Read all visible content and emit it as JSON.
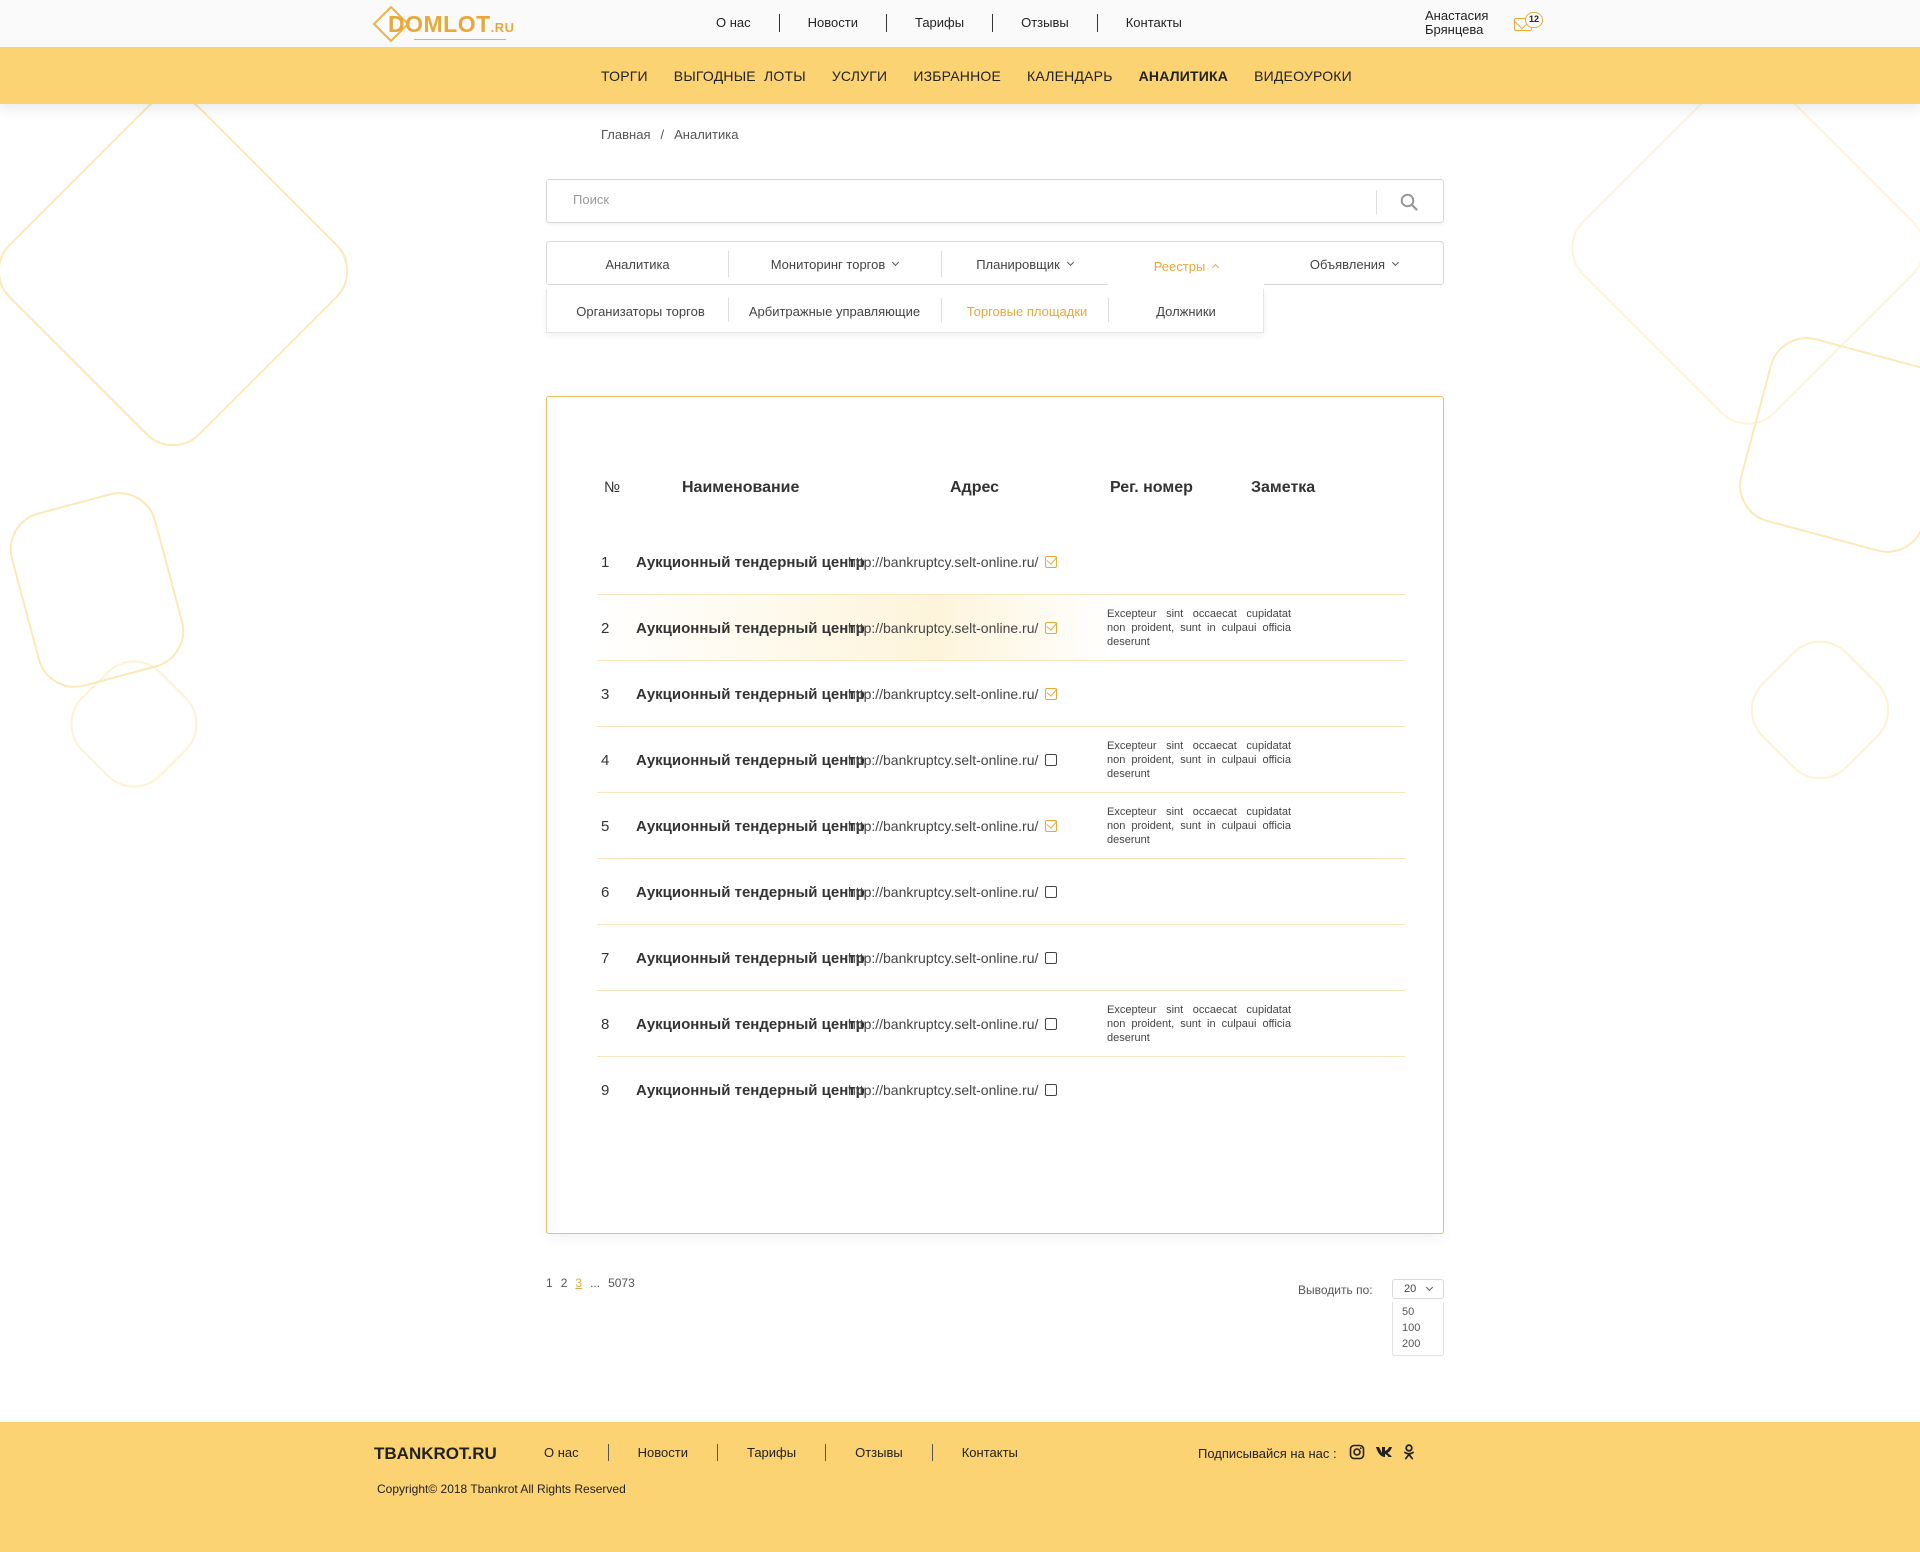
{
  "header": {
    "logo_main": "DOMLOT",
    "logo_suffix": ".RU",
    "top_nav": [
      "О нас",
      "Новости",
      "Тарифы",
      "Отзывы",
      "Контакты"
    ],
    "user_first_name": "Анастасия",
    "user_last_name": "Брянцева",
    "mail_count": "12"
  },
  "main_nav": [
    "ТОРГИ",
    "ВЫГОДНЫЕ  ЛОТЫ",
    "УСЛУГИ",
    "ИЗБРАННОЕ",
    "КАЛЕНДАРЬ",
    "АНАЛИТИКА",
    "ВИДЕОУРОКИ"
  ],
  "main_nav_active": "АНАЛИТИКА",
  "breadcrumb": {
    "home": "Главная",
    "separator": "/",
    "current": "Аналитика"
  },
  "search": {
    "placeholder": "Поиск",
    "value": ""
  },
  "tabs": [
    {
      "label": "Аналитика",
      "dropdown": false
    },
    {
      "label": "Мониторинг торгов",
      "dropdown": true
    },
    {
      "label": "Планировщик",
      "dropdown": true
    },
    {
      "label": "Реестры",
      "dropdown": true,
      "open": true
    },
    {
      "label": "Объявления",
      "dropdown": true
    }
  ],
  "subtabs": [
    "Организаторы торгов",
    "Арбитражные управляющие",
    "Торговые площадки",
    "Должники"
  ],
  "subtab_active": "Торговые площадки",
  "table": {
    "headers": {
      "num": "№",
      "name": "Наименование",
      "address": "Адрес",
      "reg": "Рег. номер",
      "note": "Заметка"
    },
    "rows": [
      {
        "num": "1",
        "name": "Аукционный тендерный центр",
        "address": "http://bankruptcy.selt-online.ru/",
        "checked": true,
        "note": ""
      },
      {
        "num": "2",
        "name": "Аукционный тендерный центр",
        "address": "http://bankruptcy.selt-online.ru/",
        "checked": true,
        "note": "Excepteur sint occaecat cupidatat non proident, sunt in culpaui officia deserunt"
      },
      {
        "num": "3",
        "name": "Аукционный тендерный центр",
        "address": "http://bankruptcy.selt-online.ru/",
        "checked": true,
        "note": ""
      },
      {
        "num": "4",
        "name": "Аукционный тендерный центр",
        "address": "http://bankruptcy.selt-online.ru/",
        "checked": false,
        "note": "Excepteur sint occaecat cupidatat non proident, sunt in culpaui officia deserunt"
      },
      {
        "num": "5",
        "name": "Аукционный тендерный центр",
        "address": "http://bankruptcy.selt-online.ru/",
        "checked": true,
        "note": "Excepteur sint occaecat cupidatat non proident, sunt in culpaui officia deserunt"
      },
      {
        "num": "6",
        "name": "Аукционный тендерный центр",
        "address": "http://bankruptcy.selt-online.ru/",
        "checked": false,
        "note": ""
      },
      {
        "num": "7",
        "name": "Аукционный тендерный центр",
        "address": "http://bankruptcy.selt-online.ru/",
        "checked": false,
        "note": ""
      },
      {
        "num": "8",
        "name": "Аукционный тендерный центр",
        "address": "http://bankruptcy.selt-online.ru/",
        "checked": false,
        "note": "Excepteur sint occaecat cupidatat non proident, sunt in culpaui officia deserunt"
      },
      {
        "num": "9",
        "name": "Аукционный тендерный центр",
        "address": "http://bankruptcy.selt-online.ru/",
        "checked": false,
        "note": ""
      }
    ]
  },
  "pagination": {
    "pages": [
      "1",
      "2",
      "3",
      "...",
      "5073"
    ],
    "current": "3"
  },
  "per_page": {
    "label": "Выводить по:",
    "selected": "20",
    "options": [
      "50",
      "100",
      "200"
    ]
  },
  "footer": {
    "brand": "TBANKROT.RU",
    "nav": [
      "О нас",
      "Новости",
      "Тарифы",
      "Отзывы",
      "Контакты"
    ],
    "subscribe": "Подписывайся на нас :",
    "social": [
      "instagram-icon",
      "vk-icon",
      "odnoklassniki-icon"
    ],
    "copyright": "Copyright© 2018 Tbankrot All Rights Reserved"
  },
  "colors": {
    "accent": "#e6a93a",
    "nav_bg": "#fbd372",
    "card_border": "#f0c063"
  }
}
